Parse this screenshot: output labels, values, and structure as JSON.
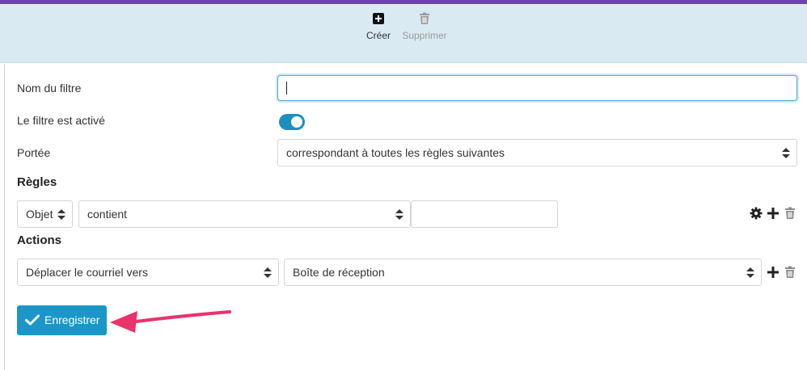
{
  "toolbar": {
    "create_label": "Créer",
    "delete_label": "Supprimer"
  },
  "form": {
    "name_label": "Nom du filtre",
    "name_value": "",
    "active_label": "Le filtre est activé",
    "active": true,
    "scope_label": "Portée",
    "scope_value": "correspondant à toutes les règles suivantes"
  },
  "rules": {
    "title": "Règles",
    "field_value": "Objet",
    "operator_value": "contient",
    "match_value": ""
  },
  "actions": {
    "title": "Actions",
    "action_value": "Déplacer le courriel vers",
    "target_value": "Boîte de réception"
  },
  "save_label": "Enregistrer",
  "colors": {
    "accent": "#1a97c8",
    "toggle_on": "#1c8fbf",
    "toolbar_bg": "#d9eaf3",
    "top_stripe": "#6f3fb5",
    "annotation_arrow": "#e8336b"
  },
  "icons": {
    "create": "plus-square-icon",
    "delete": "trash-icon",
    "settings": "gear-icon",
    "add": "plus-icon",
    "save": "checkmark-icon",
    "select": "updown-chevron-icon"
  }
}
